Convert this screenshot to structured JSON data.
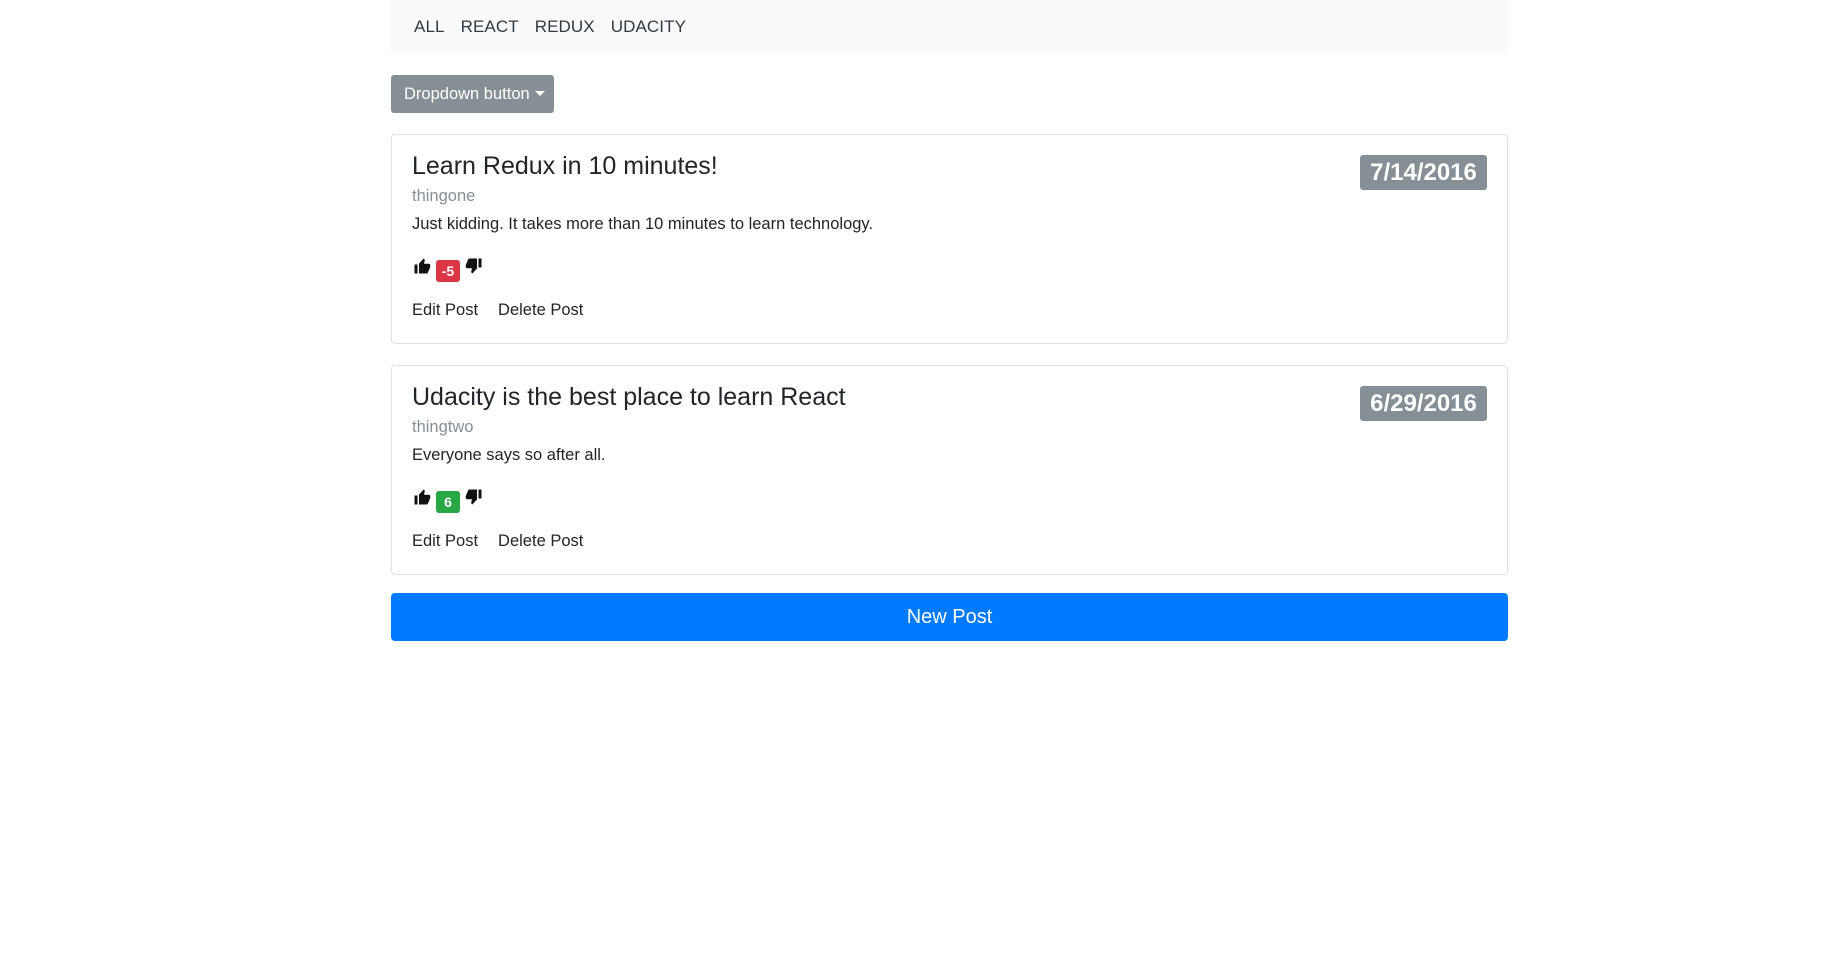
{
  "nav": {
    "items": [
      {
        "label": "ALL"
      },
      {
        "label": "REACT"
      },
      {
        "label": "REDUX"
      },
      {
        "label": "UDACITY"
      }
    ]
  },
  "dropdown": {
    "label": "Dropdown button"
  },
  "posts": [
    {
      "title": "Learn Redux in 10 minutes!",
      "author": "thingone",
      "body": "Just kidding. It takes more than 10 minutes to learn technology.",
      "date": "7/14/2016",
      "score": "-5",
      "score_color": "#dc3545",
      "edit_label": "Edit Post",
      "delete_label": "Delete Post"
    },
    {
      "title": "Udacity is the best place to learn React",
      "author": "thingtwo",
      "body": "Everyone says so after all.",
      "date": "6/29/2016",
      "score": "6",
      "score_color": "#28a745",
      "edit_label": "Edit Post",
      "delete_label": "Delete Post"
    }
  ],
  "new_post": {
    "label": "New Post"
  },
  "colors": {
    "primary": "#007bff",
    "secondary": "#868e96",
    "danger": "#dc3545",
    "success": "#28a745"
  },
  "icons": {
    "upvote": "thumbs-up-icon",
    "downvote": "thumbs-down-icon"
  }
}
